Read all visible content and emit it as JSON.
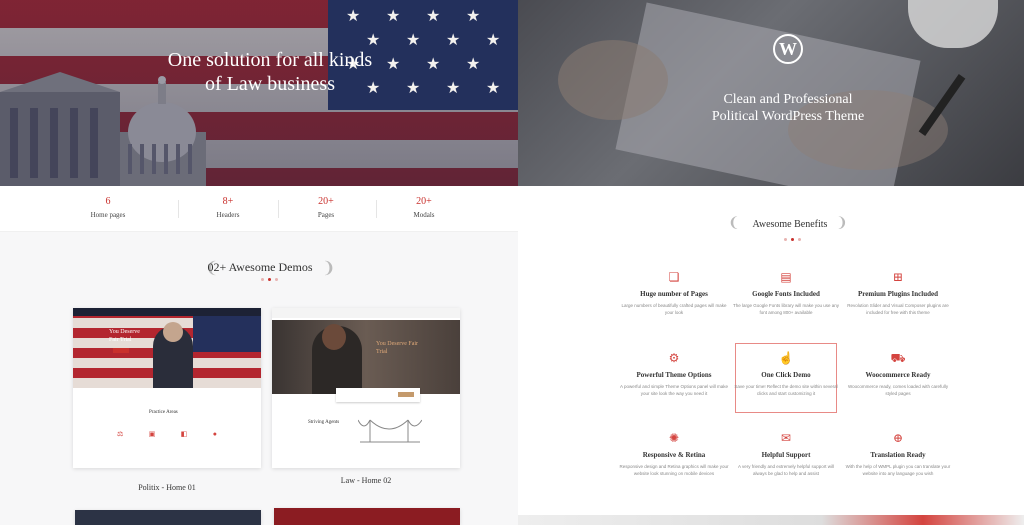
{
  "hero_left": {
    "title_line1": "One solution for all kinds",
    "title_line2": "of Law business"
  },
  "hero_right": {
    "logo_letter": "W",
    "title_line1": "Clean and Professional",
    "title_line2": "Political WordPress Theme"
  },
  "stats": [
    {
      "num": "6",
      "label": "Home pages"
    },
    {
      "num": "8+",
      "label": "Headers"
    },
    {
      "num": "20+",
      "label": "Pages"
    },
    {
      "num": "20+",
      "label": "Modals"
    }
  ],
  "demos": {
    "title": "02+ Awesome Demos",
    "items": [
      {
        "caption": "Politix - Home 01",
        "hero_text": "You Deserve Fair Trial",
        "section": "Practice Areas"
      },
      {
        "caption": "Law - Home 02",
        "hero_text": "You Deserve Fair Trial",
        "section": "Striving Agents"
      }
    ]
  },
  "benefits": {
    "title": "Awesome Benefits",
    "items": [
      {
        "icon": "layers-icon",
        "title": "Huge number of Pages",
        "desc": "Large numbers of beautifully crafted pages will make your look"
      },
      {
        "icon": "font-icon",
        "title": "Google Fonts Included",
        "desc": "The large Google Fonts library will make you use any font among 800+ available"
      },
      {
        "icon": "plugin-icon",
        "title": "Premium Plugins Included",
        "desc": "Revolution Slider and Visual Composer plugins are included for free with this theme"
      },
      {
        "icon": "gear-icon",
        "title": "Powerful Theme Options",
        "desc": "A powerful and simple Theme Options panel will make your site look the way you need it"
      },
      {
        "icon": "click-icon",
        "title": "One Click Demo",
        "desc": "Save your time! Reflect the demo site within several clicks and start customizing it"
      },
      {
        "icon": "cart-icon",
        "title": "Woocommerce Ready",
        "desc": "Woocommerce ready, comes loaded with carefully styled pages"
      },
      {
        "icon": "retina-icon",
        "title": "Responsive & Retina",
        "desc": "Responsive design and Retina graphics will make your website look stunning on mobile devices"
      },
      {
        "icon": "support-icon",
        "title": "Helpful Support",
        "desc": "A very friendly and extremely helpful support will always be glad to help and assist"
      },
      {
        "icon": "globe-icon",
        "title": "Translation Ready",
        "desc": "With the help of WMPL plugin you can translate your website into any language you wish"
      }
    ]
  }
}
